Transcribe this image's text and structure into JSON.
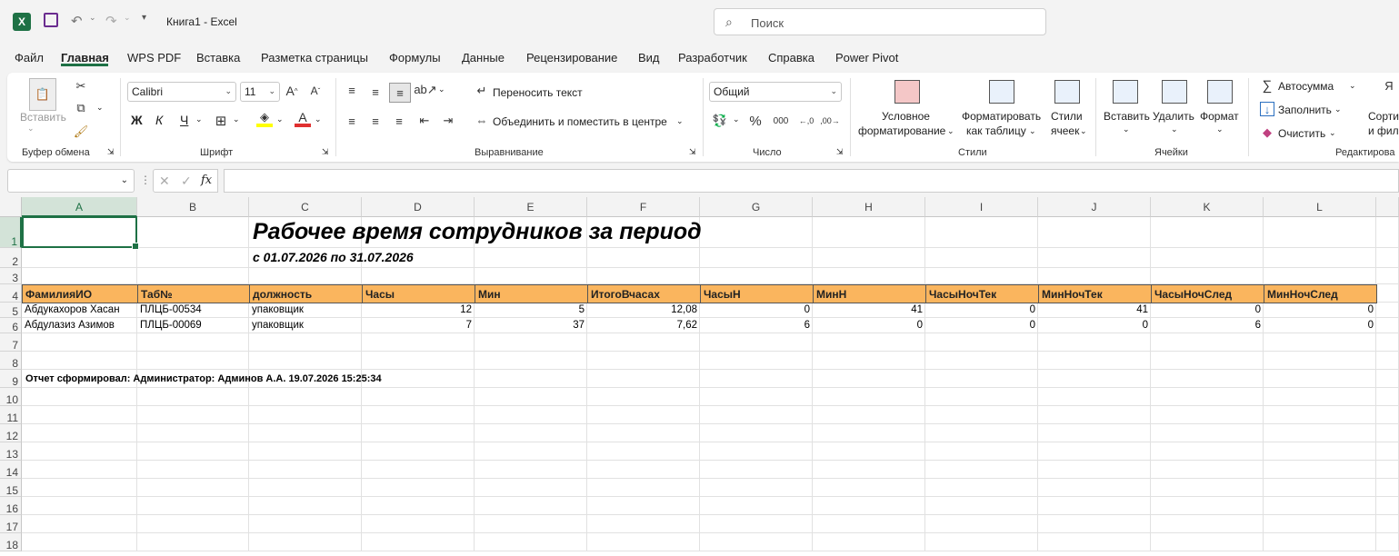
{
  "title_bar": {
    "app_logo": "X",
    "doc_title": "Книга1  -  Excel",
    "search_placeholder": "Поиск"
  },
  "menu": [
    "Файл",
    "Главная",
    "WPS PDF",
    "Вставка",
    "Разметка страницы",
    "Формулы",
    "Данные",
    "Рецензирование",
    "Вид",
    "Разработчик",
    "Справка",
    "Power Pivot"
  ],
  "ribbon": {
    "clipboard": {
      "label": "Буфер обмена",
      "paste": "Вставить"
    },
    "font": {
      "label": "Шрифт",
      "name": "Calibri",
      "size": "11",
      "bold": "Ж",
      "italic": "К",
      "underline": "Ч"
    },
    "alignment": {
      "label": "Выравнивание",
      "wrap": "Переносить текст",
      "merge": "Объединить и поместить в центре"
    },
    "number": {
      "label": "Число",
      "format": "Общий"
    },
    "styles": {
      "label": "Стили",
      "cond1": "Условное",
      "cond2": "форматирование",
      "tbl1": "Форматировать",
      "tbl2": "как таблицу",
      "cs1": "Стили",
      "cs2": "ячеек"
    },
    "cells": {
      "label": "Ячейки",
      "insert": "Вставить",
      "delete": "Удалить",
      "format": "Формат"
    },
    "editing": {
      "label": "Редактирова",
      "autosum": "Автосумма",
      "fill": "Заполнить",
      "clear": "Очистить",
      "sort1": "Сорти",
      "sort2": "и фил"
    }
  },
  "formula_bar": {
    "name_box": "",
    "fx": "fx",
    "content": ""
  },
  "sheet": {
    "columns": [
      "A",
      "B",
      "C",
      "D",
      "E",
      "F",
      "G",
      "H",
      "I",
      "J",
      "K",
      "L"
    ],
    "rows": [
      "1",
      "2",
      "3",
      "4",
      "5",
      "6",
      "7",
      "8",
      "9",
      "10",
      "11",
      "12",
      "13",
      "14",
      "15",
      "16",
      "17",
      "18"
    ],
    "title": "Рабочее время сотрудников за период",
    "subtitle": "с 01.07.2026 по 31.07.2026",
    "headers": [
      "ФамилияИО",
      "Таб№",
      "должность",
      "Часы",
      "Мин",
      "ИтогоВчасах",
      "ЧасыН",
      "МинН",
      "ЧасыНочТек",
      "МинНочТек",
      "ЧасыНочСлед",
      "МинНочСлед"
    ],
    "data": [
      [
        "Абдукахоров Хасан",
        "ПЛЦБ-00534",
        "упаковщик",
        "12",
        "5",
        "12,08",
        "0",
        "41",
        "0",
        "41",
        "0",
        "0"
      ],
      [
        "Абдулазиз Азимов",
        "ПЛЦБ-00069",
        "упаковщик",
        "7",
        "37",
        "7,62",
        "6",
        "0",
        "0",
        "0",
        "6",
        "0"
      ]
    ],
    "footer": "Отчет сформировал: Администратор: Админов А.А. 19.07.2026 15:25:34"
  }
}
